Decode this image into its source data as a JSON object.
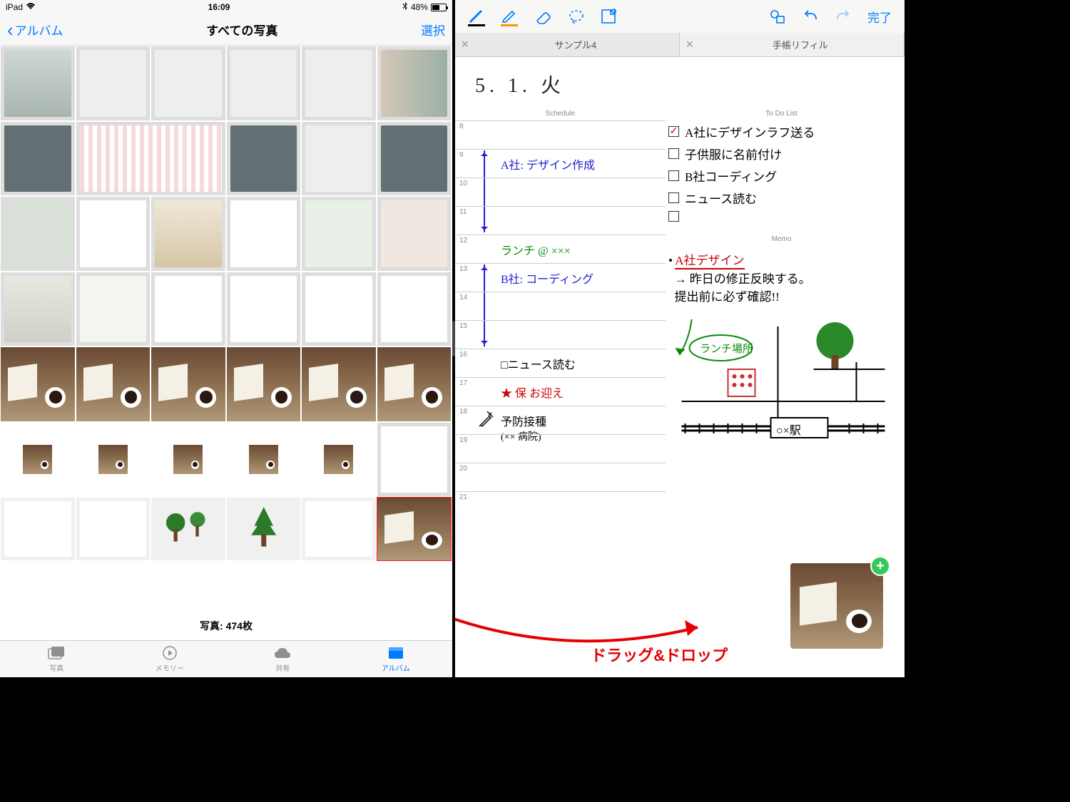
{
  "statusbar": {
    "device": "iPad",
    "time": "16:09",
    "battery_pct": "48%"
  },
  "photos": {
    "back_label": "アルバム",
    "title": "すべての写真",
    "select_label": "選択",
    "count_label": "写真: 474枚",
    "tabs": {
      "photos": "写真",
      "memories": "メモリー",
      "shared": "共有",
      "albums": "アルバム"
    }
  },
  "noteapp": {
    "done_label": "完了",
    "doctabs": [
      "サンプル4",
      "手帳リフィル"
    ],
    "date": "5. 1. 火",
    "sections": {
      "schedule": "Schedule",
      "todo": "To Do List",
      "memo": "Memo"
    },
    "hours": [
      "8",
      "9",
      "10",
      "11",
      "12",
      "13",
      "14",
      "15",
      "16",
      "17",
      "18",
      "19",
      "20",
      "21"
    ],
    "schedule_items": {
      "nine": "A社: デザイン作成",
      "twelve": "ランチ @ ×××",
      "thirteen": "B社: コーディング",
      "sixteen": "□ニュース読む",
      "seventeen": "★ 保 お迎え",
      "eighteen1": "予防接種",
      "eighteen2": "(×× 病院)"
    },
    "todos": [
      {
        "done": true,
        "text": "A社にデザインラフ送る"
      },
      {
        "done": false,
        "text": "子供服に名前付け"
      },
      {
        "done": false,
        "text": "B社コーディング"
      },
      {
        "done": false,
        "text": "ニュース読む"
      },
      {
        "done": false,
        "text": ""
      }
    ],
    "memo": {
      "l1": "A社デザイン",
      "l2": "→ 昨日の修正反映する。",
      "l3": "提出前に必ず確認!!",
      "map_label": "ランチ場所",
      "station": "○×駅"
    }
  },
  "overlay": {
    "dragdrop": "ドラッグ&ドロップ"
  }
}
